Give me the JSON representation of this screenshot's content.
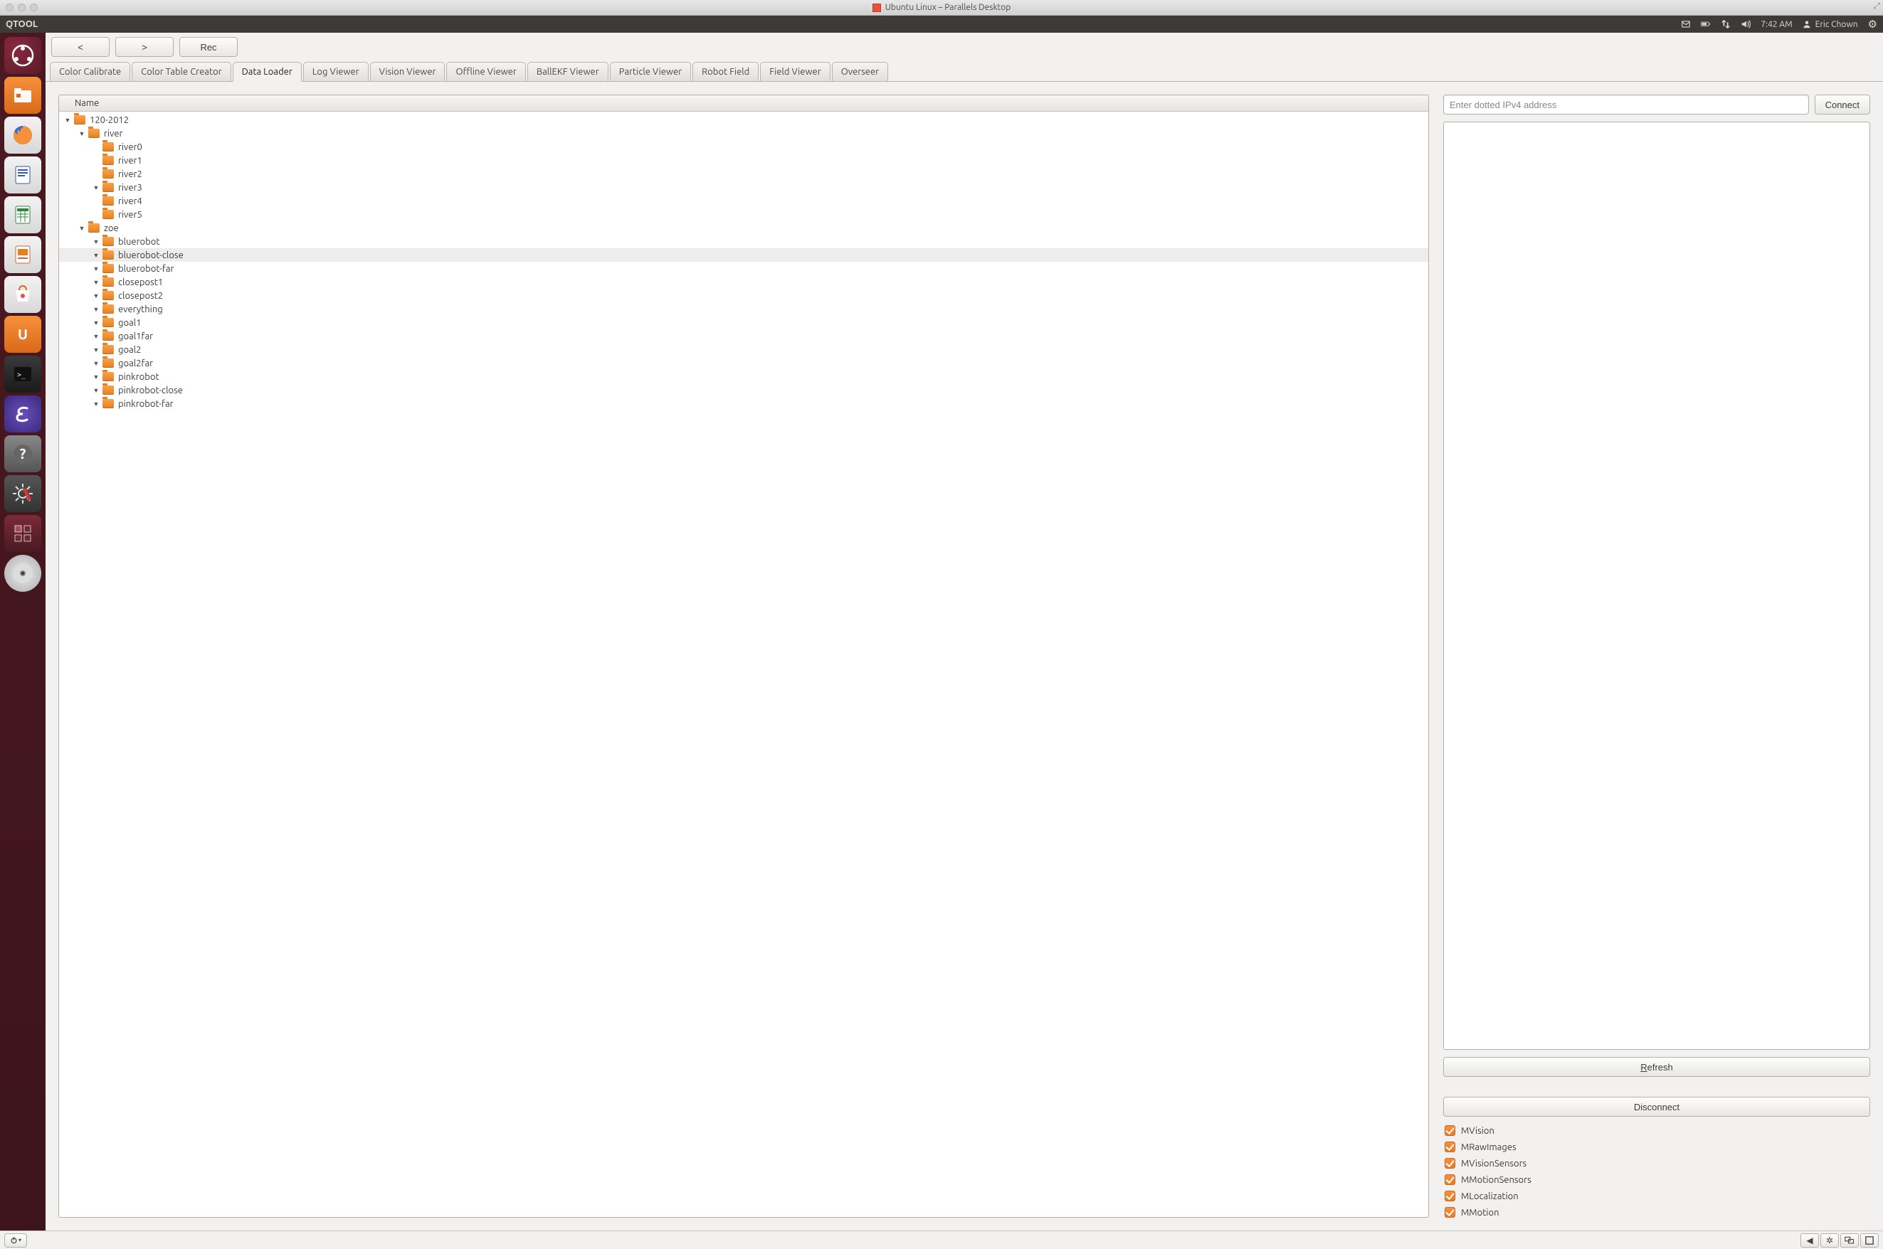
{
  "mac": {
    "title": "Ubuntu Linux – Parallels Desktop"
  },
  "panel": {
    "app_menu": "QTOOL",
    "time": "7:42 AM",
    "user": "Eric Chown"
  },
  "launcher": [
    {
      "name": "dash",
      "class": "li-dash"
    },
    {
      "name": "files",
      "class": "li-files"
    },
    {
      "name": "firefox",
      "class": "li-firefox"
    },
    {
      "name": "writer",
      "class": "li-writer"
    },
    {
      "name": "calc",
      "class": "li-calc"
    },
    {
      "name": "impress",
      "class": "li-impress"
    },
    {
      "name": "software-center",
      "class": "li-usc"
    },
    {
      "name": "ubuntu-one",
      "class": "li-uone"
    },
    {
      "name": "terminal",
      "class": "li-term"
    },
    {
      "name": "emacs",
      "class": "li-emacs"
    },
    {
      "name": "help",
      "class": "li-help"
    },
    {
      "name": "settings",
      "class": "li-settings"
    },
    {
      "name": "workspace-switcher",
      "class": "li-workspace"
    },
    {
      "name": "media-disc",
      "class": "li-disc"
    }
  ],
  "toolbar": {
    "back": "<",
    "forward": ">",
    "rec": "Rec"
  },
  "tabs": [
    {
      "label": "Color Calibrate",
      "active": false
    },
    {
      "label": "Color Table Creator",
      "active": false
    },
    {
      "label": "Data Loader",
      "active": true
    },
    {
      "label": "Log Viewer",
      "active": false
    },
    {
      "label": "Vision Viewer",
      "active": false
    },
    {
      "label": "Offline Viewer",
      "active": false
    },
    {
      "label": "BallEKF Viewer",
      "active": false
    },
    {
      "label": "Particle Viewer",
      "active": false
    },
    {
      "label": "Robot Field",
      "active": false
    },
    {
      "label": "Field Viewer",
      "active": false
    },
    {
      "label": "Overseer",
      "active": false
    }
  ],
  "tree": {
    "header": "Name",
    "rows": [
      {
        "depth": 0,
        "expander": "down",
        "label": "120-2012",
        "selected": false
      },
      {
        "depth": 1,
        "expander": "down",
        "label": "river",
        "selected": false
      },
      {
        "depth": 2,
        "expander": "none",
        "label": "river0",
        "selected": false
      },
      {
        "depth": 2,
        "expander": "none",
        "label": "river1",
        "selected": false
      },
      {
        "depth": 2,
        "expander": "none",
        "label": "river2",
        "selected": false
      },
      {
        "depth": 2,
        "expander": "down",
        "label": "river3",
        "selected": false
      },
      {
        "depth": 2,
        "expander": "none",
        "label": "river4",
        "selected": false
      },
      {
        "depth": 2,
        "expander": "none",
        "label": "river5",
        "selected": false
      },
      {
        "depth": 1,
        "expander": "down",
        "label": "zoe",
        "selected": false
      },
      {
        "depth": 2,
        "expander": "down",
        "label": "bluerobot",
        "selected": false
      },
      {
        "depth": 2,
        "expander": "down",
        "label": "bluerobot-close",
        "selected": true
      },
      {
        "depth": 2,
        "expander": "down",
        "label": "bluerobot-far",
        "selected": false
      },
      {
        "depth": 2,
        "expander": "down",
        "label": "closepost1",
        "selected": false
      },
      {
        "depth": 2,
        "expander": "down",
        "label": "closepost2",
        "selected": false
      },
      {
        "depth": 2,
        "expander": "down",
        "label": "everything",
        "selected": false
      },
      {
        "depth": 2,
        "expander": "down",
        "label": "goal1",
        "selected": false
      },
      {
        "depth": 2,
        "expander": "down",
        "label": "goal1far",
        "selected": false
      },
      {
        "depth": 2,
        "expander": "down",
        "label": "goal2",
        "selected": false
      },
      {
        "depth": 2,
        "expander": "down",
        "label": "goal2far",
        "selected": false
      },
      {
        "depth": 2,
        "expander": "down",
        "label": "pinkrobot",
        "selected": false
      },
      {
        "depth": 2,
        "expander": "down",
        "label": "pinkrobot-close",
        "selected": false
      },
      {
        "depth": 2,
        "expander": "down",
        "label": "pinkrobot-far",
        "selected": false
      }
    ]
  },
  "right": {
    "ip_placeholder": "Enter dotted IPv4 address",
    "connect": "Connect",
    "refresh_pre": "R",
    "refresh_rest": "efresh",
    "disconnect": "Disconnect",
    "checks": [
      "MVision",
      "MRawImages",
      "MVisionSensors",
      "MMotionSensors",
      "MLocalization",
      "MMotion"
    ]
  }
}
